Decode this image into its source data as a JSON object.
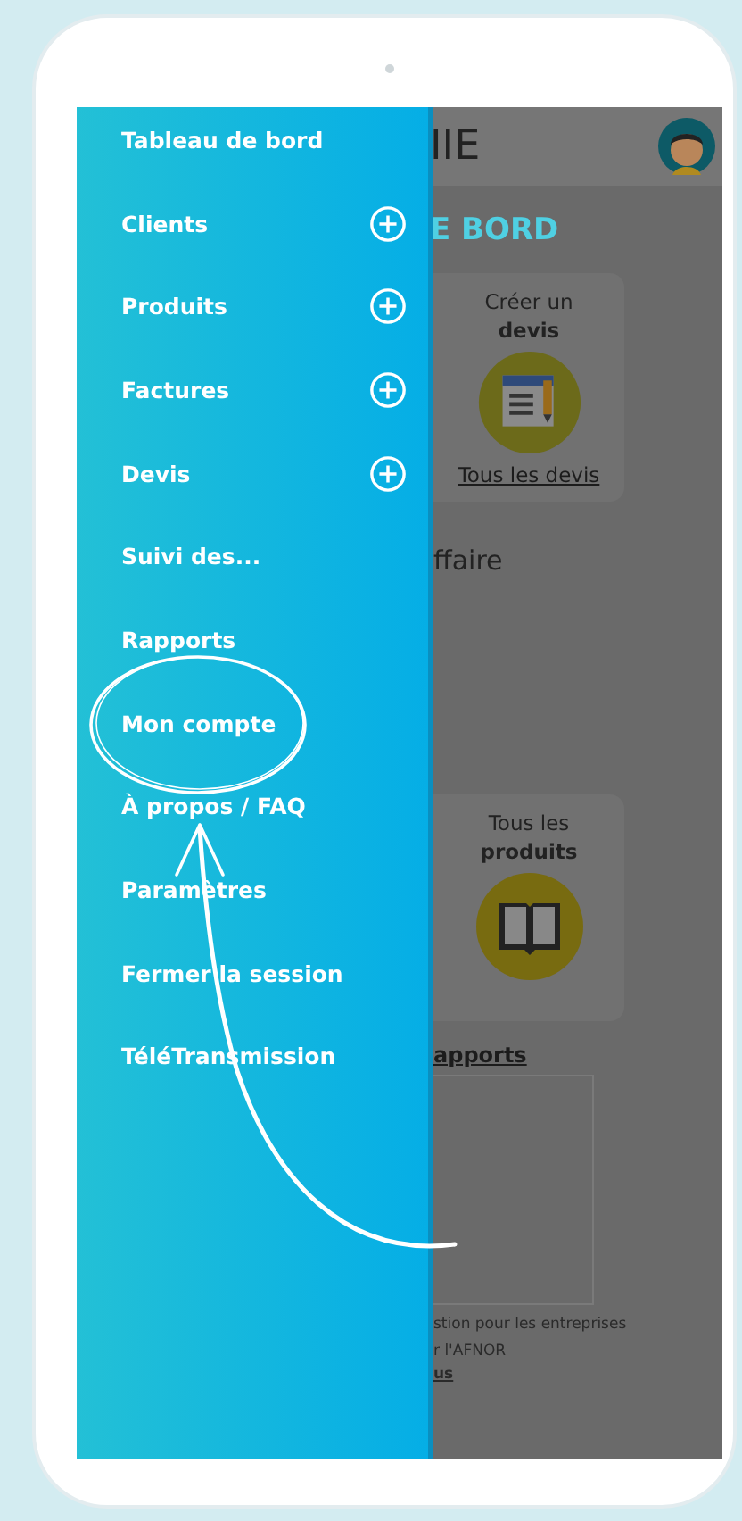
{
  "drawer": {
    "items": [
      {
        "label": "Tableau de bord",
        "kind": "link"
      },
      {
        "label": "Clients",
        "kind": "section"
      },
      {
        "label": "Produits",
        "kind": "section"
      },
      {
        "label": "Factures",
        "kind": "section"
      },
      {
        "label": "Devis",
        "kind": "section"
      },
      {
        "label": "Suivi des...",
        "kind": "link"
      },
      {
        "label": "Rapports",
        "kind": "link"
      },
      {
        "label": "Mon compte",
        "kind": "link"
      },
      {
        "label": "À propos / FAQ",
        "kind": "link"
      },
      {
        "label": "Paramètres",
        "kind": "link"
      },
      {
        "label": "Fermer la session",
        "kind": "link"
      },
      {
        "label": "TéléTransmission",
        "kind": "link"
      }
    ]
  },
  "background_page": {
    "header_title": "IIE",
    "page_title": "E BORD",
    "cards": [
      {
        "kind": "quote",
        "line1": "Créer un",
        "line2": "devis",
        "link": "Tous les devis"
      },
      {
        "kind": "catalog",
        "line1": "Tous les",
        "line2": "produits"
      }
    ],
    "section_heading": "ffaire",
    "reports_link": "apports",
    "footer": [
      "stion pour les entreprises",
      "r l'AFNOR",
      "us"
    ]
  }
}
